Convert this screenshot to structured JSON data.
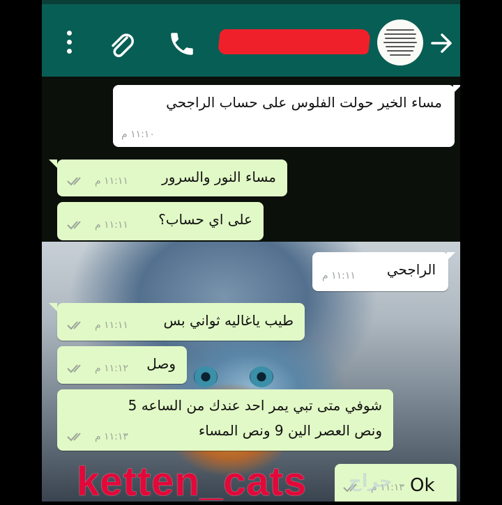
{
  "header": {
    "icons": [
      "more-vert-icon",
      "paperclip-icon",
      "phone-icon",
      "arrow-right-icon"
    ],
    "color": "#075e54"
  },
  "messages": [
    {
      "dir": "in",
      "text": "مساء الخير حولت الفلوس على حساب الراجحي",
      "time": "١١:١٠ م"
    },
    {
      "dir": "out",
      "text": "مساء النور والسرور",
      "time": "١١:١١ م"
    },
    {
      "dir": "out",
      "text": "على اي حساب؟",
      "time": "١١:١١ م"
    },
    {
      "dir": "in",
      "text": "الراجحي",
      "time": "١١:١١ م"
    },
    {
      "dir": "out",
      "text": "طيب ياغاليه ثواني بس",
      "time": "١١:١١ م"
    },
    {
      "dir": "out",
      "text": "وصل",
      "time": "١١:١٢ م"
    },
    {
      "dir": "out",
      "text": "شوفي متى تبي يمر احد عندك من الساعه 5",
      "text2": "ونص العصر الين 9 ونص المساء",
      "time": "١١:١٣ م"
    },
    {
      "dir": "out",
      "text": "Ok",
      "time": "١١:١٣ م"
    }
  ],
  "watermark": "ketten_cats",
  "logo_text": "حراج"
}
